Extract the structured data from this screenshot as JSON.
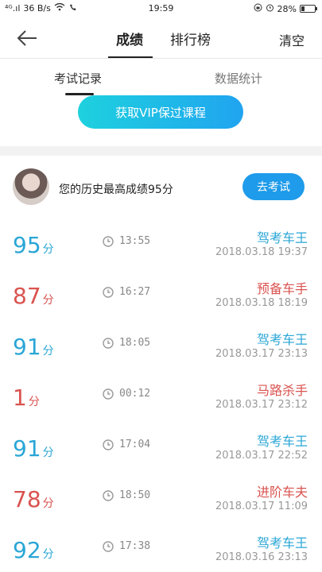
{
  "status_bar": {
    "signal": "⁴ᴳ.ıl",
    "speed": "36 B/s",
    "time": "19:59",
    "battery": "28%",
    "battery_level": 0.28
  },
  "nav": {
    "tab_score": "成绩",
    "tab_rank": "排行榜",
    "clear": "清空"
  },
  "subtabs": {
    "records": "考试记录",
    "stats": "数据统计"
  },
  "vip_button": "获取VIP保过课程",
  "best": {
    "text": "您的历史最高成绩95分",
    "go_button": "去考试"
  },
  "colors": {
    "blue": "#2aa6d6",
    "red": "#d9534f",
    "accent": "#1e9bea"
  },
  "records": [
    {
      "score": "95",
      "unit": "分",
      "duration": "13:55",
      "rank": "驾考车王",
      "date": "2018.03.18  19:37",
      "color": "blue"
    },
    {
      "score": "87",
      "unit": "分",
      "duration": "16:27",
      "rank": "预备车手",
      "date": "2018.03.18  18:19",
      "color": "red"
    },
    {
      "score": "91",
      "unit": "分",
      "duration": "18:05",
      "rank": "驾考车王",
      "date": "2018.03.17  23:13",
      "color": "blue"
    },
    {
      "score": "1",
      "unit": "分",
      "duration": "00:12",
      "rank": "马路杀手",
      "date": "2018.03.17  23:12",
      "color": "red"
    },
    {
      "score": "91",
      "unit": "分",
      "duration": "17:04",
      "rank": "驾考车王",
      "date": "2018.03.17  22:52",
      "color": "blue"
    },
    {
      "score": "78",
      "unit": "分",
      "duration": "18:50",
      "rank": "进阶车夫",
      "date": "2018.03.17  11:09",
      "color": "red"
    },
    {
      "score": "92",
      "unit": "分",
      "duration": "17:38",
      "rank": "驾考车王",
      "date": "2018.03.16  23:13",
      "color": "blue"
    }
  ]
}
